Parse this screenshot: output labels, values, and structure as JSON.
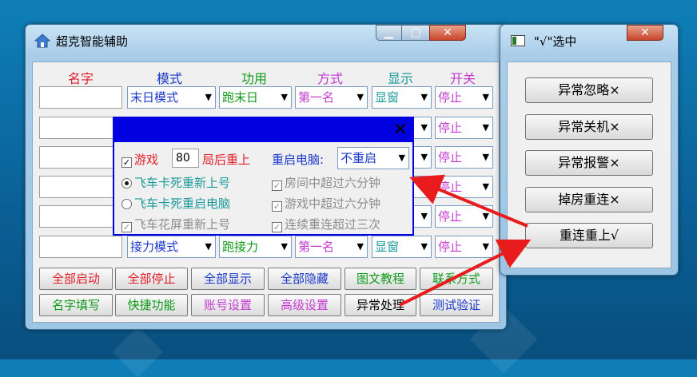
{
  "main_window": {
    "title": "超克智能辅助",
    "headers": [
      "名字",
      "模式",
      "功用",
      "方式",
      "显示",
      "开关"
    ],
    "header_colors": [
      "#e0202a",
      "#1a38c9",
      "#109a1a",
      "#c43ad0",
      "#1a9a9a",
      "#c43ad0"
    ],
    "rows": [
      {
        "mode": "末日模式",
        "func": "跑末日",
        "method": "第一名",
        "display": "显窗",
        "switch": "停止"
      },
      {
        "switch": "停止"
      },
      {
        "switch": "停止"
      },
      {
        "switch": "停止"
      },
      {
        "switch": "停止"
      },
      {
        "mode": "接力模式",
        "func": "跑接力",
        "method": "第一名",
        "display": "显窗",
        "switch": "停止"
      }
    ],
    "buttons_row1": [
      "全部启动",
      "全部停止",
      "全部显示",
      "全部隐藏",
      "图文教程",
      "联系方式"
    ],
    "buttons_row1_colors": [
      "#e0202a",
      "#e0202a",
      "#1a38c9",
      "#1a38c9",
      "#109a1a",
      "#109a1a"
    ],
    "buttons_row2": [
      "名字填写",
      "快捷功能",
      "账号设置",
      "高级设置",
      "异常处理",
      "测试验证"
    ],
    "buttons_row2_colors": [
      "#109a1a",
      "#109a1a",
      "#c43ad0",
      "#c43ad0",
      "#000000",
      "#1a38c9"
    ]
  },
  "popup": {
    "close_glyph": "✕",
    "game_label": "游戏",
    "game_value": "80",
    "after_label": "局后重上",
    "restart_label": "重启电脑:",
    "restart_value": "不重启",
    "option1": "飞车卡死重新上号",
    "option2": "飞车卡死重启电脑",
    "option3": "飞车花屏重新上号",
    "check1": "房间中超过六分钟",
    "check2": "游戏中超过六分钟",
    "check3": "连续重连超过三次",
    "check_mark": "✓"
  },
  "side_window": {
    "title": "\"√\"选中",
    "buttons": [
      "异常忽略×",
      "异常关机×",
      "异常报警×",
      "掉房重连×",
      "重连重上√"
    ]
  },
  "colors": {
    "accent_red": "#e0202a",
    "accent_blue": "#1a38c9",
    "popup_blue": "#0000e0",
    "arrow_red": "#e81c1c"
  }
}
